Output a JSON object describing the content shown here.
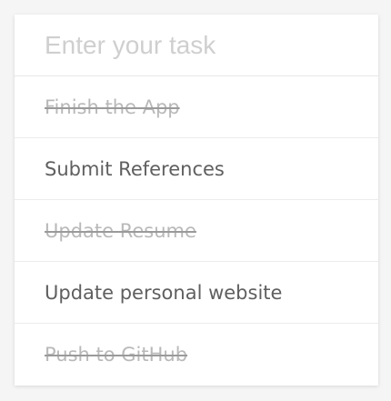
{
  "task_input": {
    "placeholder": "Enter your task",
    "value": ""
  },
  "todos": [
    {
      "label": "Finish the App",
      "completed": true
    },
    {
      "label": "Submit References",
      "completed": false
    },
    {
      "label": "Update Resume",
      "completed": true
    },
    {
      "label": "Update personal website",
      "completed": false
    },
    {
      "label": "Push to GitHub",
      "completed": true
    }
  ],
  "colors": {
    "background": "#f5f5f5",
    "card": "#ffffff",
    "text_active": "#5f5f5f",
    "text_completed": "#b9b9b9",
    "placeholder": "#cfcfcf",
    "divider": "#ececec"
  }
}
